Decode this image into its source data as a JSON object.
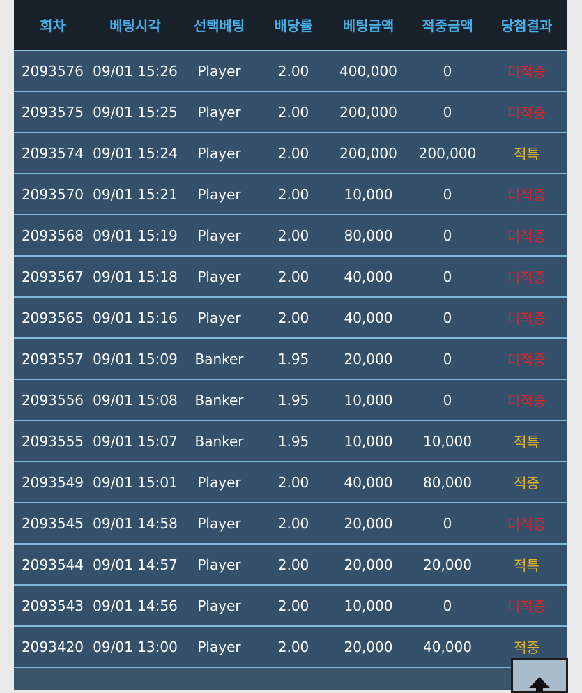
{
  "table": {
    "headers": [
      "회차",
      "베팅시각",
      "선택베팅",
      "배당률",
      "베팅금액",
      "적중금액",
      "당첨결과"
    ],
    "rows": [
      {
        "round": "2093576",
        "time": "09/01 15:26",
        "pick": "Player",
        "odds": "2.00",
        "bet": "400,000",
        "win": "0",
        "result": "미적중",
        "status": "lose"
      },
      {
        "round": "2093575",
        "time": "09/01 15:25",
        "pick": "Player",
        "odds": "2.00",
        "bet": "200,000",
        "win": "0",
        "result": "미적중",
        "status": "lose"
      },
      {
        "round": "2093574",
        "time": "09/01 15:24",
        "pick": "Player",
        "odds": "2.00",
        "bet": "200,000",
        "win": "200,000",
        "result": "적특",
        "status": "win"
      },
      {
        "round": "2093570",
        "time": "09/01 15:21",
        "pick": "Player",
        "odds": "2.00",
        "bet": "10,000",
        "win": "0",
        "result": "미적중",
        "status": "lose"
      },
      {
        "round": "2093568",
        "time": "09/01 15:19",
        "pick": "Player",
        "odds": "2.00",
        "bet": "80,000",
        "win": "0",
        "result": "미적중",
        "status": "lose"
      },
      {
        "round": "2093567",
        "time": "09/01 15:18",
        "pick": "Player",
        "odds": "2.00",
        "bet": "40,000",
        "win": "0",
        "result": "미적중",
        "status": "lose"
      },
      {
        "round": "2093565",
        "time": "09/01 15:16",
        "pick": "Player",
        "odds": "2.00",
        "bet": "40,000",
        "win": "0",
        "result": "미적중",
        "status": "lose"
      },
      {
        "round": "2093557",
        "time": "09/01 15:09",
        "pick": "Banker",
        "odds": "1.95",
        "bet": "20,000",
        "win": "0",
        "result": "미적중",
        "status": "lose"
      },
      {
        "round": "2093556",
        "time": "09/01 15:08",
        "pick": "Banker",
        "odds": "1.95",
        "bet": "10,000",
        "win": "0",
        "result": "미적중",
        "status": "lose"
      },
      {
        "round": "2093555",
        "time": "09/01 15:07",
        "pick": "Banker",
        "odds": "1.95",
        "bet": "10,000",
        "win": "10,000",
        "result": "적특",
        "status": "win"
      },
      {
        "round": "2093549",
        "time": "09/01 15:01",
        "pick": "Player",
        "odds": "2.00",
        "bet": "40,000",
        "win": "80,000",
        "result": "적중",
        "status": "win"
      },
      {
        "round": "2093545",
        "time": "09/01 14:58",
        "pick": "Player",
        "odds": "2.00",
        "bet": "20,000",
        "win": "0",
        "result": "미적중",
        "status": "lose"
      },
      {
        "round": "2093544",
        "time": "09/01 14:57",
        "pick": "Player",
        "odds": "2.00",
        "bet": "20,000",
        "win": "20,000",
        "result": "적특",
        "status": "win"
      },
      {
        "round": "2093543",
        "time": "09/01 14:56",
        "pick": "Player",
        "odds": "2.00",
        "bet": "10,000",
        "win": "0",
        "result": "미적중",
        "status": "lose"
      },
      {
        "round": "2093420",
        "time": "09/01 13:00",
        "pick": "Player",
        "odds": "2.00",
        "bet": "20,000",
        "win": "40,000",
        "result": "적중",
        "status": "win"
      }
    ]
  },
  "scroll_top": {
    "icon": "arrow-up-icon"
  },
  "colors": {
    "header_bg": "#18212a",
    "header_text": "#47aee9",
    "row_bg": "#34506a",
    "row_border": "#7fb7d8",
    "lose": "#d9262b",
    "win": "#e6b321"
  }
}
